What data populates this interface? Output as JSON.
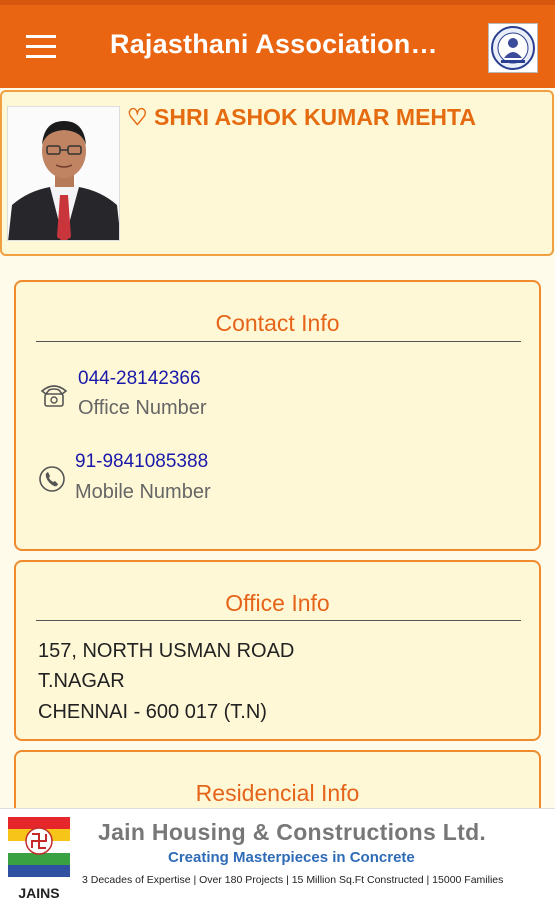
{
  "app": {
    "title": "Rajasthani Association…",
    "accent_color": "#ea6512",
    "menu_icon": "hamburger-menu-icon",
    "logo_icon": "association-logo-icon"
  },
  "profile": {
    "name": "♡ SHRI ASHOK KUMAR MEHTA",
    "photo": "member-photo"
  },
  "contact": {
    "title": "Contact Info",
    "office_number": "044-28142366",
    "office_label": "Office Number",
    "office_icon": "telephone-icon",
    "mobile_number": "91-9841085388",
    "mobile_label": "Mobile Number",
    "mobile_icon": "phone-icon"
  },
  "office": {
    "title": "Office Info",
    "lines": [
      "157, NORTH USMAN ROAD",
      "T.NAGAR",
      "CHENNAI - 600 017 (T.N)"
    ]
  },
  "residence": {
    "title": "Residencial Info"
  },
  "ad": {
    "logo_text": "JAINS",
    "title": "Jain Housing & Constructions Ltd.",
    "tagline": "Creating Masterpieces in Concrete",
    "details": "3 Decades of Expertise | Over 180 Projects | 15 Million Sq.Ft Constructed | 15000 Families"
  }
}
